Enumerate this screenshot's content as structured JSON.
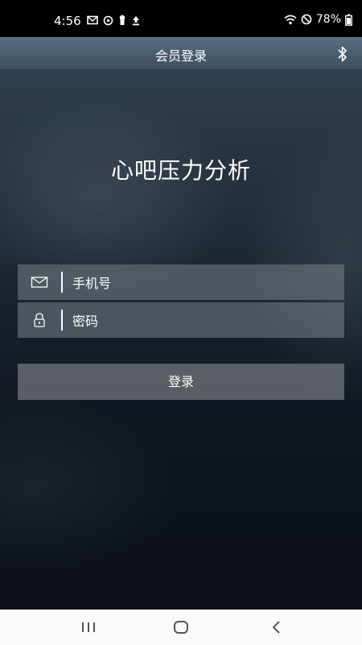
{
  "status_bar": {
    "time": "4:56",
    "left_icons": [
      "mail-icon",
      "sync-icon",
      "keyhole-icon",
      "upload-icon"
    ],
    "right_icons": [
      "wifi-icon",
      "dnd-icon",
      "battery-icon"
    ],
    "battery": "78%"
  },
  "app_bar": {
    "title": "会员登录",
    "right_icon": "bluetooth-icon"
  },
  "main": {
    "app_name": "心吧压力分析",
    "phone_field": {
      "icon": "mail-icon",
      "placeholder": "手机号",
      "value": ""
    },
    "password_field": {
      "icon": "lock-icon",
      "placeholder": "密码",
      "value": ""
    },
    "login_button": "登录"
  },
  "nav_bar": {
    "buttons": [
      "recents-icon",
      "home-icon",
      "back-icon"
    ]
  },
  "colors": {
    "app_bar": "#4c6073",
    "background_dark": "#0c1117",
    "field_bg": "#6e7680",
    "button_bg": "#7a7e84",
    "nav_bar": "#fafafa"
  }
}
